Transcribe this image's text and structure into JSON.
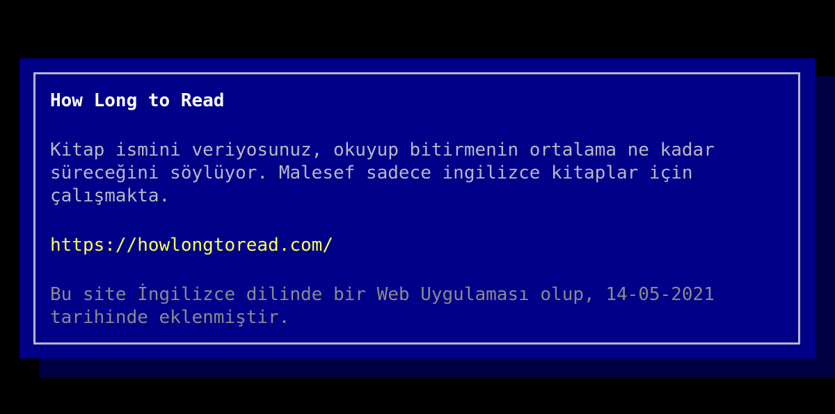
{
  "card": {
    "title": "How Long to Read",
    "description": "Kitap ismini veriyosunuz, okuyup bitirmenin ortalama ne kadar süreceğini söylüyor. Malesef sadece ingilizce kitaplar için çalışmakta.",
    "url": "https://howlongtoread.com/",
    "footer": "Bu site İngilizce dilinde bir Web Uygulaması olup, 14-05-2021 tarihinde eklenmiştir."
  },
  "colors": {
    "background": "#000000",
    "window": "#000088",
    "shadow": "#000044",
    "border": "#b8b8c8",
    "title": "#ffffff",
    "text": "#b8b8c8",
    "link": "#ffff55",
    "footer": "#8a8a8a"
  }
}
